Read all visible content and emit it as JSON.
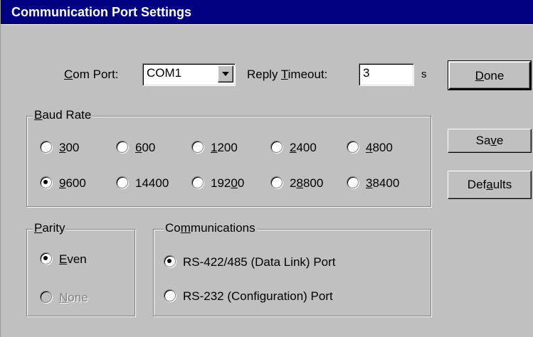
{
  "window": {
    "title": "Communication Port Settings"
  },
  "com_port": {
    "label_prefix": "",
    "label_accel": "C",
    "label_rest": "om Port:",
    "value": "COM1"
  },
  "reply_timeout": {
    "label_prefix": "Reply ",
    "label_accel": "T",
    "label_rest": "imeout:",
    "value": "3",
    "unit": "s"
  },
  "buttons": {
    "done": {
      "accel": "D",
      "rest": "one"
    },
    "save": {
      "pre": "Sa",
      "accel": "v",
      "rest": "e"
    },
    "defaults": {
      "pre": "Def",
      "accel": "a",
      "rest": "ults"
    }
  },
  "baud_rate": {
    "legend_accel": "B",
    "legend_rest": "aud Rate",
    "options": [
      {
        "pre": "",
        "accel": "3",
        "rest": "00",
        "checked": false
      },
      {
        "pre": "",
        "accel": "6",
        "rest": "00",
        "checked": false
      },
      {
        "pre": "",
        "accel": "1",
        "rest": "200",
        "checked": false
      },
      {
        "pre": "",
        "accel": "2",
        "rest": "400",
        "checked": false
      },
      {
        "pre": "",
        "accel": "4",
        "rest": "800",
        "checked": false
      },
      {
        "pre": "",
        "accel": "9",
        "rest": "600",
        "checked": true
      },
      {
        "pre": "14400",
        "accel": "",
        "rest": "",
        "checked": false
      },
      {
        "pre": "192",
        "accel": "0",
        "rest": "0",
        "checked": false
      },
      {
        "pre": "2",
        "accel": "8",
        "rest": "800",
        "checked": false
      },
      {
        "pre": "",
        "accel": "3",
        "rest": "8400",
        "checked": false
      }
    ]
  },
  "parity": {
    "legend_accel": "P",
    "legend_rest": "arity",
    "options": [
      {
        "accel": "E",
        "rest": "ven",
        "checked": true,
        "disabled": false
      },
      {
        "accel": "N",
        "rest": "one",
        "checked": false,
        "disabled": true
      }
    ]
  },
  "communications": {
    "legend_pre": "Co",
    "legend_accel": "m",
    "legend_rest": "munications",
    "options": [
      {
        "label": "RS-422/485 (Data Link) Port",
        "checked": true
      },
      {
        "label": "RS-232 (Configuration) Port",
        "checked": false
      }
    ]
  }
}
